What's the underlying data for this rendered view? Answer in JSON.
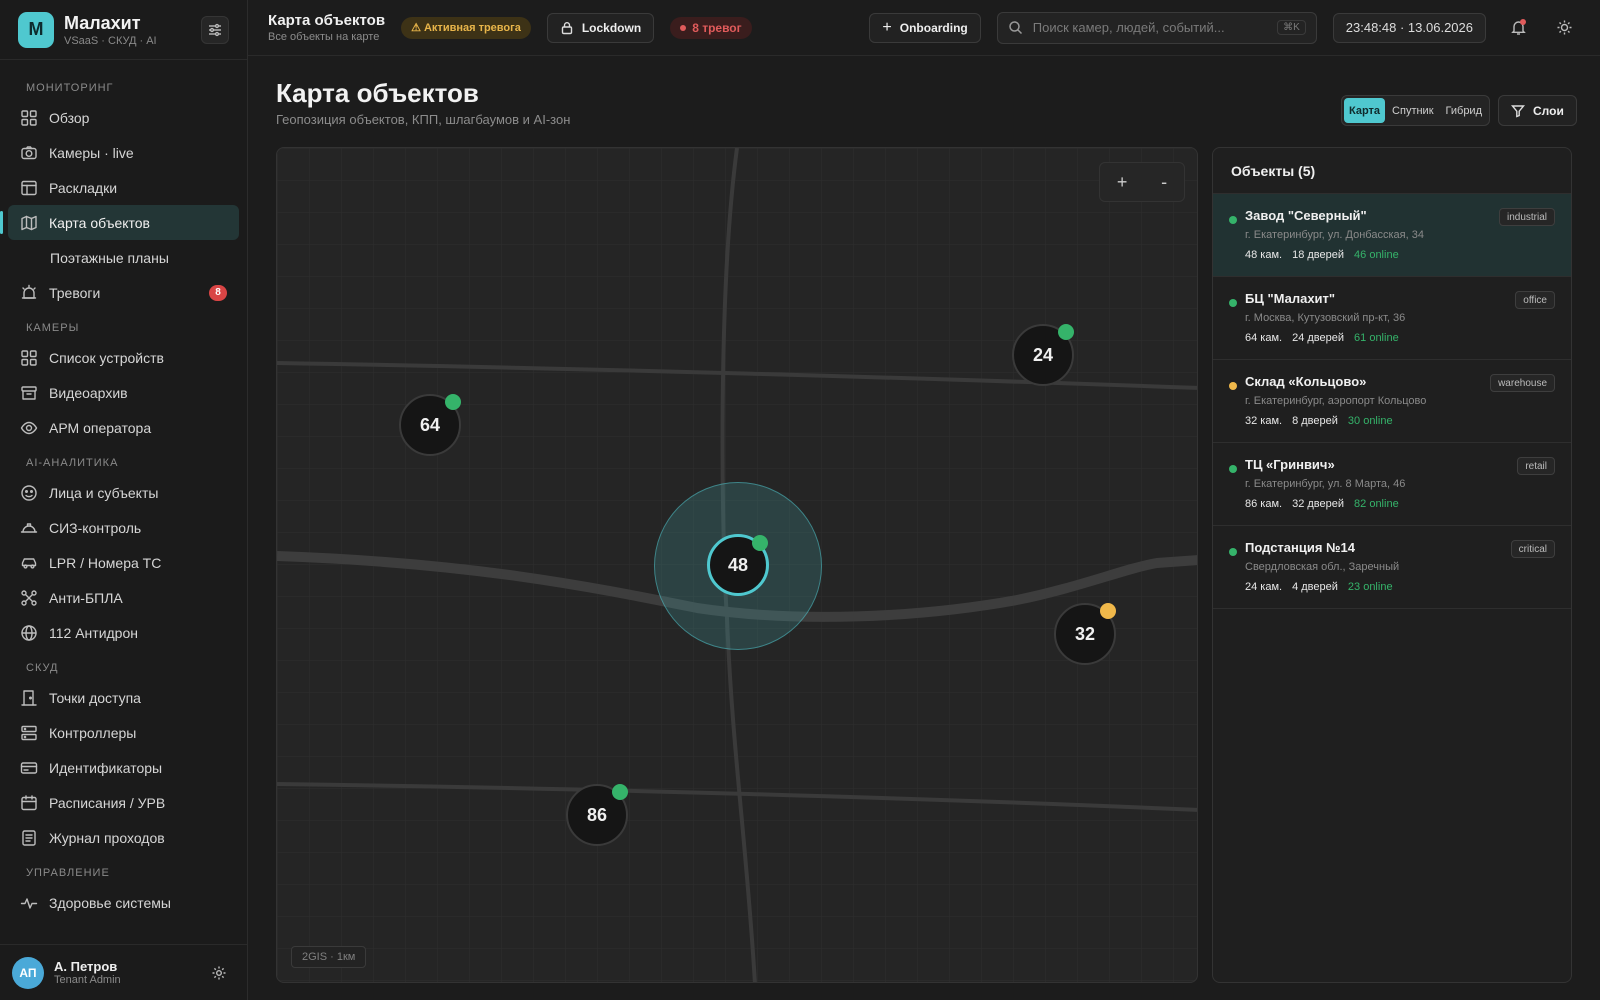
{
  "brand": {
    "logo": "M",
    "name": "Малахит",
    "sub": "VSaaS · СКУД · AI"
  },
  "nav": {
    "sections": [
      {
        "title": "Мониторинг",
        "items": [
          {
            "label": "Обзор",
            "icon": "grid-icon"
          },
          {
            "label": "Камеры · live",
            "icon": "camera-icon"
          },
          {
            "label": "Раскладки",
            "icon": "layout-icon"
          },
          {
            "label": "Карта объектов",
            "icon": "map-icon",
            "active": true
          },
          {
            "label": "Поэтажные планы",
            "sub": true
          },
          {
            "label": "Тревоги",
            "icon": "alarm-icon",
            "badge": "8"
          }
        ]
      },
      {
        "title": "Камеры",
        "items": [
          {
            "label": "Список устройств",
            "icon": "grid-icon"
          },
          {
            "label": "Видеоархив",
            "icon": "archive-icon"
          },
          {
            "label": "АРМ оператора",
            "icon": "eye-icon"
          }
        ]
      },
      {
        "title": "AI-аналитика",
        "items": [
          {
            "label": "Лица и субъекты",
            "icon": "face-icon"
          },
          {
            "label": "СИЗ-контроль",
            "icon": "helmet-icon"
          },
          {
            "label": "LPR / Номера ТС",
            "icon": "car-icon"
          },
          {
            "label": "Анти-БПЛА",
            "icon": "drone-icon"
          },
          {
            "label": "112 Антидрон",
            "icon": "radar-icon"
          }
        ]
      },
      {
        "title": "СКУД",
        "items": [
          {
            "label": "Точки доступа",
            "icon": "door-icon"
          },
          {
            "label": "Контроллеры",
            "icon": "server-icon"
          },
          {
            "label": "Идентификаторы",
            "icon": "card-icon"
          },
          {
            "label": "Расписания / УРВ",
            "icon": "calendar-icon"
          },
          {
            "label": "Журнал проходов",
            "icon": "journal-icon"
          }
        ]
      },
      {
        "title": "Управление",
        "items": [
          {
            "label": "Здоровье системы",
            "icon": "pulse-icon"
          }
        ]
      }
    ]
  },
  "user": {
    "initials": "АП",
    "name": "А. Петров",
    "role": "Tenant Admin"
  },
  "topbar": {
    "title": "Карта объектов",
    "subtitle": "Все объекты на карте",
    "alarm_pill": "⚠ Активная тревога",
    "lockdown": "Lockdown",
    "alarm_count": "8 тревог",
    "onboarding": "Onboarding",
    "search_placeholder": "Поиск камер, людей, событий...",
    "search_kbd": "⌘K",
    "clock": "23:48:48 · 13.06.2026"
  },
  "page": {
    "title": "Карта объектов",
    "subtitle": "Геопозиция объектов, КПП, шлагбаумов и AI-зон",
    "view_modes": [
      "Карта",
      "Спутник",
      "Гибрид"
    ],
    "active_view": "Карта",
    "layers": "Слои"
  },
  "map": {
    "zoom_in": "+",
    "zoom_out": "-",
    "scale": "2GIS · 1км",
    "markers": [
      {
        "label": "64",
        "status": "ok"
      },
      {
        "label": "24",
        "status": "ok"
      },
      {
        "label": "48",
        "status": "ok",
        "selected": true
      },
      {
        "label": "32",
        "status": "warn"
      },
      {
        "label": "86",
        "status": "ok"
      }
    ]
  },
  "objects": {
    "header": "Объекты (5)",
    "items": [
      {
        "name": "Завод \"Северный\"",
        "address": "г. Екатеринбург, ул. Донбасская, 34",
        "cams": "48 кам.",
        "doors": "18 дверей",
        "online": "46 online",
        "tag": "industrial",
        "status": "ok",
        "selected": true
      },
      {
        "name": "БЦ \"Малахит\"",
        "address": "г. Москва, Кутузовский пр-кт, 36",
        "cams": "64 кам.",
        "doors": "24 дверей",
        "online": "61 online",
        "tag": "office",
        "status": "ok"
      },
      {
        "name": "Склад «Кольцово»",
        "address": "г. Екатеринбург, аэропорт Кольцово",
        "cams": "32 кам.",
        "doors": "8 дверей",
        "online": "30 online",
        "tag": "warehouse",
        "status": "warn"
      },
      {
        "name": "ТЦ «Гринвич»",
        "address": "г. Екатеринбург, ул. 8 Марта, 46",
        "cams": "86 кам.",
        "doors": "32 дверей",
        "online": "82 online",
        "tag": "retail",
        "status": "ok"
      },
      {
        "name": "Подстанция №14",
        "address": "Свердловская обл., Заречный",
        "cams": "24 кам.",
        "doors": "4 дверей",
        "online": "23 online",
        "tag": "critical",
        "status": "ok"
      }
    ]
  },
  "colors": {
    "accent": "#4fc8cf",
    "ok": "#35b36a",
    "warn": "#f0b84a",
    "danger": "#d94545"
  }
}
